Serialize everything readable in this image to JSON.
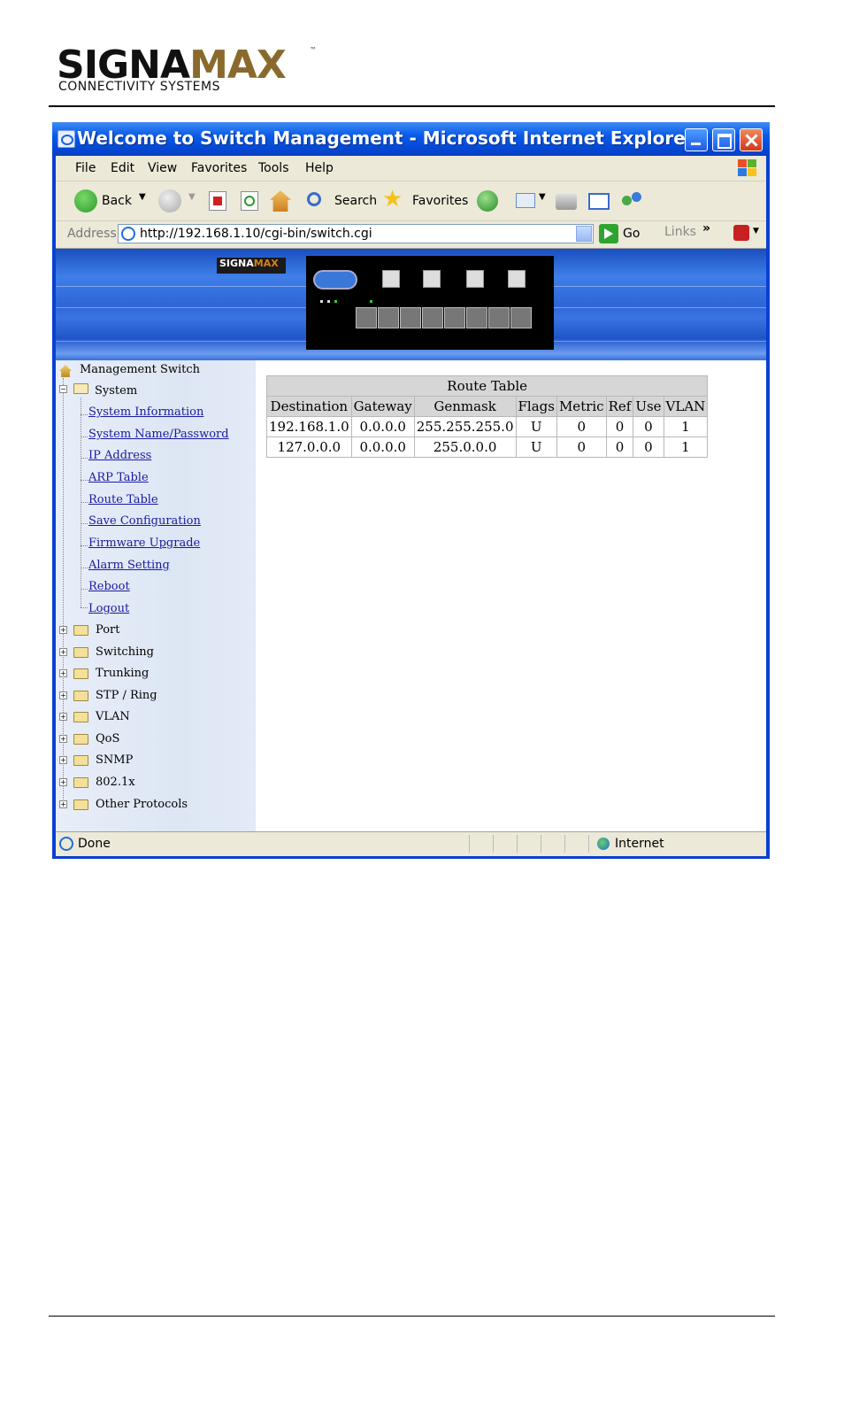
{
  "brand": {
    "name_part1": "SIGNA",
    "name_part2": "MAX",
    "trademark": "™",
    "tagline": "CONNECTIVITY SYSTEMS"
  },
  "window": {
    "title": "Welcome to Switch Management - Microsoft Internet Explorer"
  },
  "menubar": {
    "items": [
      "File",
      "Edit",
      "View",
      "Favorites",
      "Tools",
      "Help"
    ]
  },
  "toolbar": {
    "back_label": "Back",
    "search_label": "Search",
    "favorites_label": "Favorites"
  },
  "addressbar": {
    "label": "Address",
    "url": "http://192.168.1.10/cgi-bin/switch.cgi",
    "go_label": "Go",
    "links_label": "Links",
    "links_chevron": "»"
  },
  "banner": {
    "logo_part1": "SIGNA",
    "logo_part2": "MAX"
  },
  "sidebar": {
    "root": "Management Switch",
    "system": "System",
    "system_items": [
      "System Information",
      "System Name/Password",
      "IP Address",
      "ARP Table",
      "Route Table",
      "Save Configuration",
      "Firmware Upgrade",
      "Alarm Setting",
      "Reboot",
      "Logout"
    ],
    "folders": [
      "Port",
      "Switching",
      "Trunking",
      "STP / Ring",
      "VLAN",
      "QoS",
      "SNMP",
      "802.1x",
      "Other Protocols"
    ],
    "expander_plus": "+",
    "expander_minus": "−"
  },
  "route_table": {
    "caption": "Route Table",
    "columns": [
      "Destination",
      "Gateway",
      "Genmask",
      "Flags",
      "Metric",
      "Ref",
      "Use",
      "VLAN"
    ],
    "rows": [
      [
        "192.168.1.0",
        "0.0.0.0",
        "255.255.255.0",
        "U",
        "0",
        "0",
        "0",
        "1"
      ],
      [
        "127.0.0.0",
        "0.0.0.0",
        "255.0.0.0",
        "U",
        "0",
        "0",
        "0",
        "1"
      ]
    ]
  },
  "statusbar": {
    "text": "Done",
    "zone": "Internet"
  }
}
